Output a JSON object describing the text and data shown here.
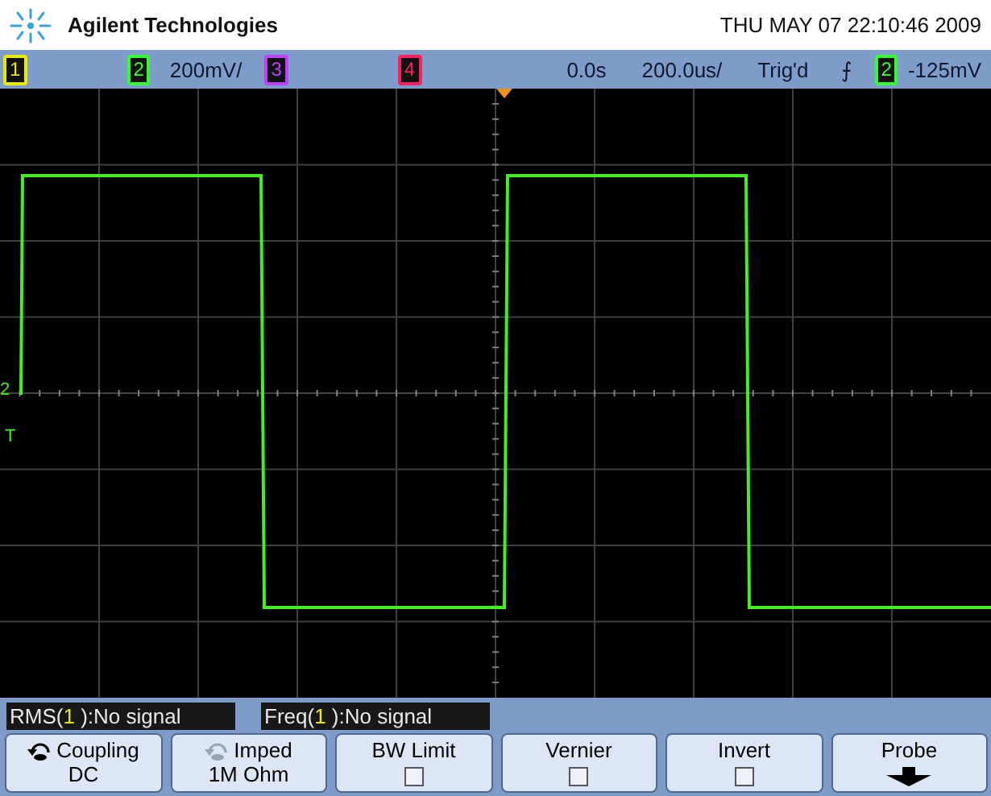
{
  "header": {
    "brand": "Agilent Technologies",
    "datetime": "THU MAY 07 22:10:46 2009"
  },
  "status_bar": [
    {
      "kind": "channel",
      "label": "1",
      "color": "#e8e800"
    },
    {
      "kind": "channel",
      "label": "2",
      "color": "#33ff33"
    },
    {
      "kind": "text",
      "text": "200mV/"
    },
    {
      "kind": "channel",
      "label": "3",
      "color": "#c040ff"
    },
    {
      "kind": "channel",
      "label": "4",
      "color": "#ff2060"
    },
    {
      "kind": "acq"
    },
    {
      "kind": "text",
      "text": "0.0s"
    },
    {
      "kind": "text",
      "text": "200.0us/"
    },
    {
      "kind": "text",
      "text": "Trig'd"
    },
    {
      "kind": "text",
      "text": "⨍"
    },
    {
      "kind": "channel",
      "label": "2",
      "color": "#33ff33"
    },
    {
      "kind": "text",
      "text": "-125mV"
    }
  ],
  "markers": {
    "ground": "2",
    "trigger": "T"
  },
  "measurements": [
    {
      "name": "RMS(",
      "source": "1",
      "rest": " ):No signal"
    },
    {
      "name": "Freq(",
      "source": "1",
      "rest": " ):No signal"
    }
  ],
  "softkeys": [
    {
      "kind": "cycle",
      "label": "Coupling",
      "value": "DC",
      "enabled": true
    },
    {
      "kind": "cycle",
      "label": "Imped",
      "value": "1M Ohm",
      "enabled": false
    },
    {
      "kind": "checkbox",
      "label": "BW Limit",
      "checked": false
    },
    {
      "kind": "checkbox",
      "label": "Vernier",
      "checked": false
    },
    {
      "kind": "checkbox",
      "label": "Invert",
      "checked": false
    },
    {
      "kind": "menu",
      "label": "Probe"
    }
  ]
}
